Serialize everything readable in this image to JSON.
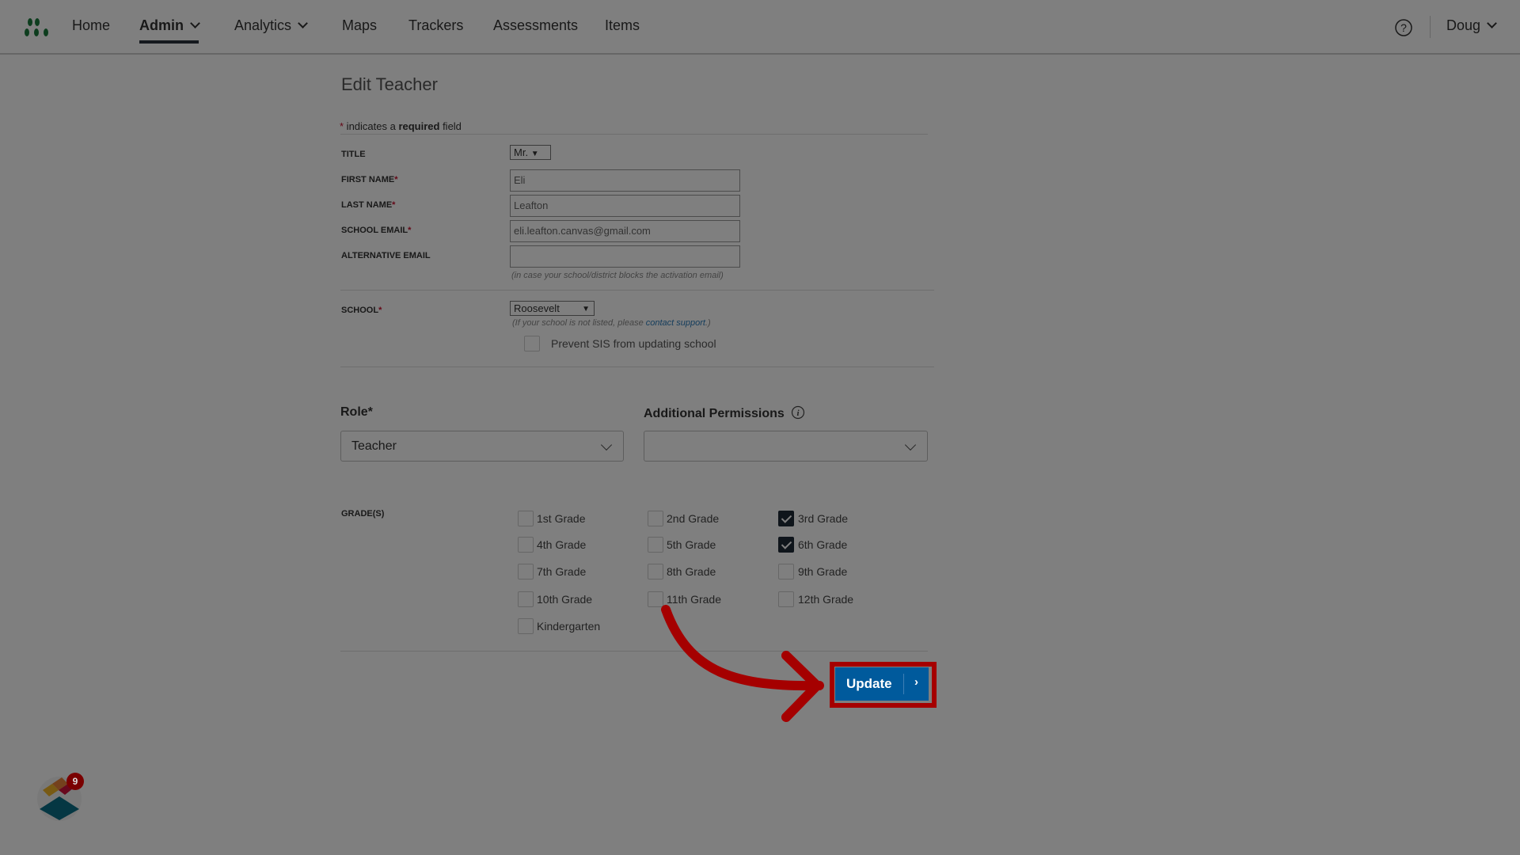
{
  "nav": {
    "items": [
      {
        "label": "Home"
      },
      {
        "label": "Admin"
      },
      {
        "label": "Analytics"
      },
      {
        "label": "Maps"
      },
      {
        "label": "Trackers"
      },
      {
        "label": "Assessments"
      },
      {
        "label": "Items"
      }
    ],
    "user": "Doug",
    "brand_color": "#1a7a3c"
  },
  "page": {
    "title": "Edit Teacher",
    "required_star": "*",
    "required_pre": " indicates a ",
    "required_bold": "required",
    "required_post": " field"
  },
  "form": {
    "title_label": "TITLE",
    "title_value": "Mr.",
    "first_label": "FIRST NAME",
    "first_value": "Eli",
    "last_label": "LAST NAME",
    "last_value": "Leafton",
    "email_label": "SCHOOL EMAIL",
    "email_value": "eli.leafton.canvas@gmail.com",
    "alt_label": "ALTERNATIVE EMAIL",
    "alt_value": "",
    "alt_hint": "(in case your school/district blocks the activation email)",
    "school_label": "SCHOOL",
    "school_value": "Roosevelt",
    "school_hint_pre": "(If your school is not listed, please ",
    "school_hint_link": "contact support",
    "school_hint_post": ".)",
    "prevent_label": "Prevent SIS from updating school",
    "role_label": "Role*",
    "role_value": "Teacher",
    "perm_label": "Additional Permissions",
    "perm_value": "",
    "grades_label": "GRADE(S)",
    "grades": [
      {
        "label": "1st Grade",
        "checked": false
      },
      {
        "label": "2nd Grade",
        "checked": false
      },
      {
        "label": "3rd Grade",
        "checked": true
      },
      {
        "label": "4th Grade",
        "checked": false
      },
      {
        "label": "5th Grade",
        "checked": false
      },
      {
        "label": "6th Grade",
        "checked": true
      },
      {
        "label": "7th Grade",
        "checked": false
      },
      {
        "label": "8th Grade",
        "checked": false
      },
      {
        "label": "9th Grade",
        "checked": false
      },
      {
        "label": "10th Grade",
        "checked": false
      },
      {
        "label": "11th Grade",
        "checked": false
      },
      {
        "label": "12th Grade",
        "checked": false
      },
      {
        "label": "Kindergarten",
        "checked": false
      }
    ],
    "update_label": "Update",
    "update_arrow": "›"
  },
  "widget": {
    "badge": "9"
  },
  "highlight_color": "#a50000",
  "button_color": "#005a9c"
}
